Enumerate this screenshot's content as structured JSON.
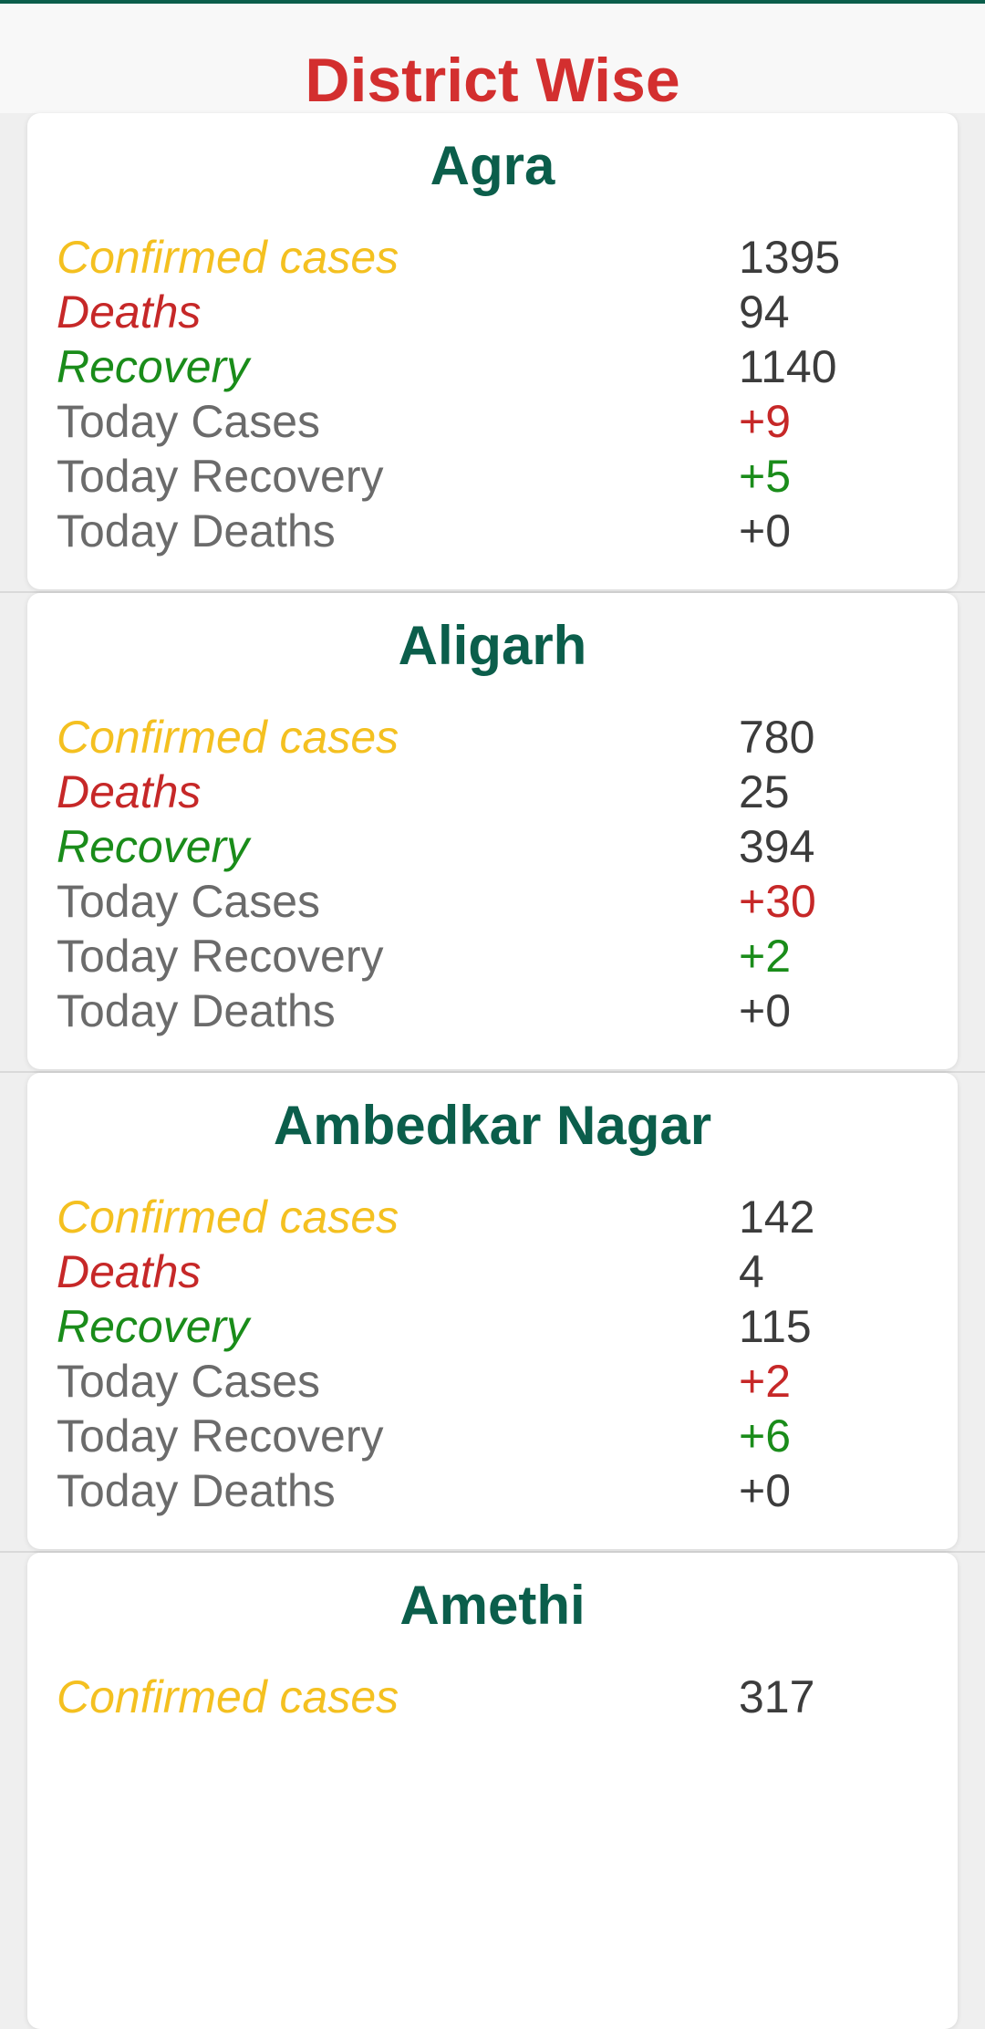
{
  "header": {
    "title": "District Wise"
  },
  "colors": {
    "title": "#d32f2f",
    "district_name": "#0b5e4b",
    "confirmed": "#f4c020",
    "deaths": "#c62828",
    "recovery": "#1a8c1a",
    "today_label": "#6b6b6b",
    "value": "#3c3c3c"
  },
  "labels": {
    "confirmed": "Confirmed cases",
    "deaths": "Deaths",
    "recovery": "Recovery",
    "today_cases": "Today Cases",
    "today_recovery": "Today Recovery",
    "today_deaths": "Today Deaths"
  },
  "districts": [
    {
      "name": "Agra",
      "confirmed": "1395",
      "deaths": "94",
      "recovery": "1140",
      "today_cases": "+9",
      "today_recovery": "+5",
      "today_deaths": "+0"
    },
    {
      "name": "Aligarh",
      "confirmed": "780",
      "deaths": "25",
      "recovery": "394",
      "today_cases": "+30",
      "today_recovery": "+2",
      "today_deaths": "+0"
    },
    {
      "name": "Ambedkar Nagar",
      "confirmed": "142",
      "deaths": "4",
      "recovery": "115",
      "today_cases": "+2",
      "today_recovery": "+6",
      "today_deaths": "+0"
    },
    {
      "name": "Amethi",
      "confirmed": "317"
    }
  ]
}
